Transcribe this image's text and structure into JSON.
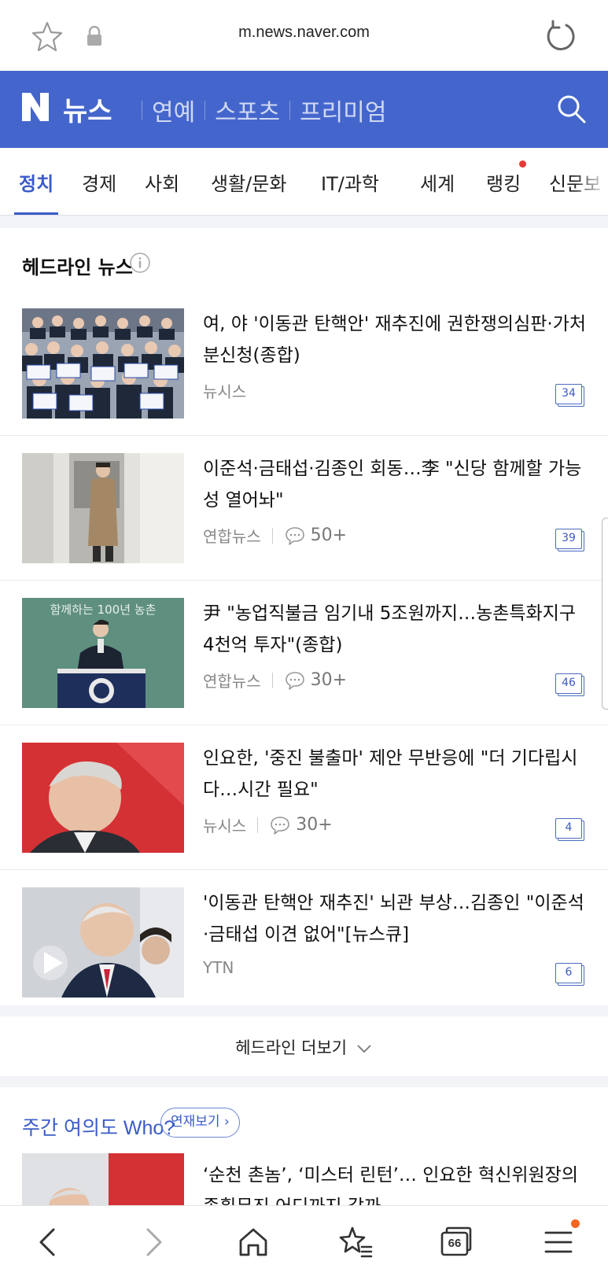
{
  "browser": {
    "url": "m.news.naver.com",
    "tab_count": "66"
  },
  "header": {
    "logo_text": "뉴스",
    "nav": [
      "연예",
      "스포츠",
      "프리미엄"
    ],
    "colors": {
      "brand": "#4466cc",
      "accent": "#3a5bc7"
    }
  },
  "tabs": {
    "items": [
      "정치",
      "경제",
      "사회",
      "생활/문화",
      "IT/과학",
      "세계",
      "랭킹",
      "신문보"
    ],
    "active": "정치"
  },
  "headlines": {
    "title": "헤드라인 뉴스",
    "articles": [
      {
        "title": "여, 야 '이동관 탄핵안' 재추진에 권한쟁의심판·가처분신청(종합)",
        "source": "뉴시스",
        "comments": "",
        "count": "34"
      },
      {
        "title": "이준석·금태섭·김종인 회동…李 \"신당 함께할 가능성 열어놔\"",
        "source": "연합뉴스",
        "comments": "50+",
        "count": "39"
      },
      {
        "title": "尹 \"농업직불금 임기내 5조원까지…농촌특화지구 4천억 투자\"(종합)",
        "source": "연합뉴스",
        "comments": "30+",
        "count": "46"
      },
      {
        "title": "인요한, '중진 불출마' 제안 무반응에 \"더 기다립시다…시간 필요\"",
        "source": "뉴시스",
        "comments": "30+",
        "count": "4"
      },
      {
        "title": "'이동관 탄핵안 재추진' 뇌관 부상…김종인 \"이준석·금태섭 이견 없어\"[뉴스큐]",
        "source": "YTN",
        "comments": "",
        "count": "6"
      }
    ],
    "more_label": "헤드라인 더보기"
  },
  "weekly": {
    "title": "주간 여의도 Who?",
    "serial_button": "연재보기",
    "headline": "‘순천 촌놈’, ‘미스터 린턴’… 인요한 혁신위원장의 종횡무진 어디까지 갈까"
  },
  "thumbnails": {
    "3_text": "함께하는 100년 농촌"
  }
}
